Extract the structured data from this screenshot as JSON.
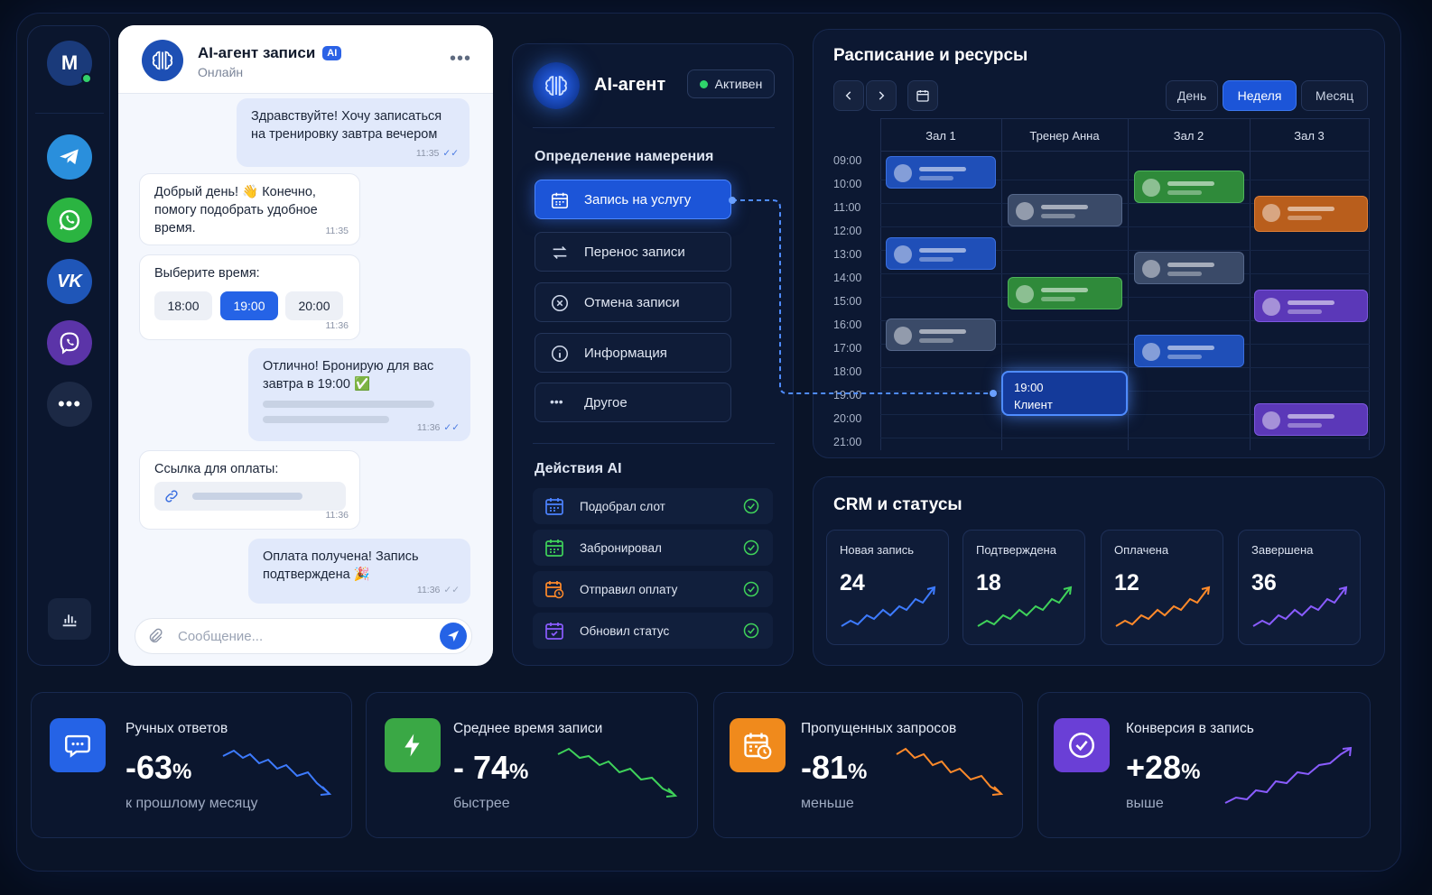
{
  "sidebar": {
    "user_initial": "M",
    "channels": [
      "telegram-icon",
      "whatsapp-icon",
      "vk-icon",
      "viber-icon",
      "more-icon"
    ]
  },
  "chat": {
    "title": "AI-агент записи",
    "badge": "AI",
    "status": "Онлайн",
    "messages": [
      {
        "text": "Здравствуйте! Хочу записаться на тренировку завтра вечером",
        "time": "11:35"
      },
      {
        "text": "Добрый день! 👋 Конечно, помогу подобрать удобное время.",
        "time": "11:35"
      },
      {
        "text": "Выберите время:",
        "time": "11:36",
        "slots": [
          "18:00",
          "19:00",
          "20:00"
        ],
        "selected": "19:00"
      },
      {
        "text": "Отлично! Бронирую для вас завтра в 19:00 ✅",
        "time": "11:36"
      },
      {
        "text": "Ссылка для оплаты:",
        "time": "11:36"
      },
      {
        "text": "Оплата получена! Запись подтверждена 🎉",
        "time": "11:36"
      }
    ],
    "input_placeholder": "Сообщение..."
  },
  "agent": {
    "title": "AI-агент",
    "status": "Активен",
    "intent_title": "Определение намерения",
    "intents": [
      "Запись на услугу",
      "Перенос записи",
      "Отмена записи",
      "Информация",
      "Другое"
    ],
    "active_intent": "Запись на услугу",
    "actions_title": "Действия AI",
    "actions": [
      "Подобрал слот",
      "Забронировал",
      "Отправил оплату",
      "Обновил статус"
    ]
  },
  "schedule": {
    "title": "Расписание и ресурсы",
    "views": [
      "День",
      "Неделя",
      "Месяц"
    ],
    "active_view": "Неделя",
    "columns": [
      "Зал 1",
      "Тренер Анна",
      "Зал 2",
      "Зал 3"
    ],
    "hours": [
      "09:00",
      "10:00",
      "11:00",
      "12:00",
      "13:00",
      "14:00",
      "15:00",
      "16:00",
      "17:00",
      "18:00",
      "19:00",
      "20:00",
      "21:00"
    ],
    "client_time": "19:00",
    "client_label": "Клиент",
    "colors": {
      "blue": "#1f4fb8",
      "gray": "#3a4a68",
      "green": "#2f8a3a",
      "orange": "#b95e1c",
      "purple": "#5b38b8"
    }
  },
  "crm": {
    "title": "CRM и статусы",
    "cards": [
      {
        "label": "Новая запись",
        "value": "24",
        "color": "#3d7bff"
      },
      {
        "label": "Подтверждена",
        "value": "18",
        "color": "#3fd25a"
      },
      {
        "label": "Оплачена",
        "value": "12",
        "color": "#ff8a2a"
      },
      {
        "label": "Завершена",
        "value": "36",
        "color": "#8a5cff"
      }
    ]
  },
  "kpis": [
    {
      "label": "Ручных ответов",
      "value": "-63",
      "unit": "%",
      "sub": "к прошлому месяцу",
      "color": "#2563e6",
      "icon": "chat-icon"
    },
    {
      "label": "Среднее время записи",
      "value": "- 74",
      "unit": "%",
      "sub": "быстрее",
      "color": "#3aa845",
      "icon": "lightning-icon"
    },
    {
      "label": "Пропущенных запросов",
      "value": "-81",
      "unit": "%",
      "sub": "меньше",
      "color": "#f08a1c",
      "icon": "calendar-clock-icon"
    },
    {
      "label": "Конверсия в запись",
      "value": "+28",
      "unit": "%",
      "sub": "выше",
      "color": "#6a3fd6",
      "icon": "check-circle-icon"
    }
  ]
}
